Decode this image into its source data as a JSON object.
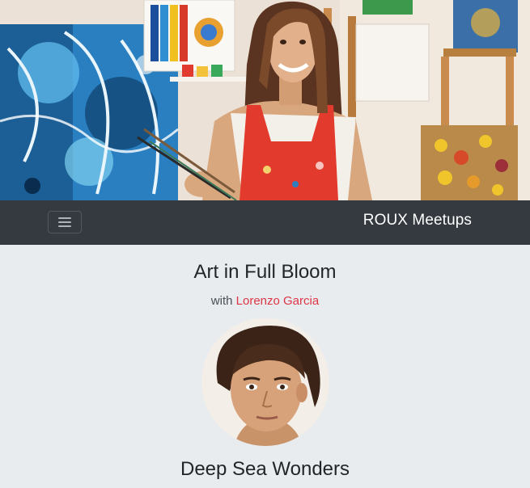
{
  "hero": {
    "image": "woman-painter-in-studio-photo"
  },
  "navbar": {
    "brand": "ROUX Meetups",
    "toggler_icon": "hamburger-menu-icon",
    "background": "#343a40"
  },
  "event": {
    "title": "Art in Full Bloom",
    "with_label": "with",
    "host_name": "Lorenzo Garcia",
    "host_color": "#dc3545",
    "host_photo": "lorenzo-garcia-portrait-photo"
  },
  "next_event": {
    "title": "Deep Sea Wonders"
  }
}
